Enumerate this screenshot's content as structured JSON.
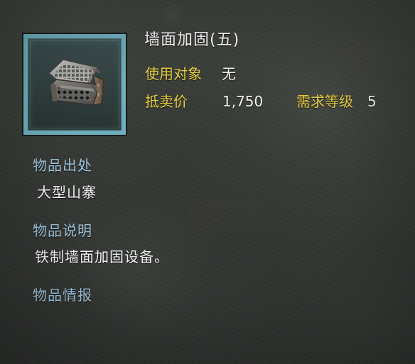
{
  "item": {
    "title": "墙面加固(五)",
    "icon": "wall-reinforcement-equipment-icon"
  },
  "properties": {
    "use_target_label": "使用对象",
    "use_target_value": "无",
    "sell_price_label": "抵卖价",
    "sell_price_value": "1,750",
    "required_level_label": "需求等级",
    "required_level_value": "5"
  },
  "sections": {
    "source_title": "物品出处",
    "source_value": "大型山寨",
    "description_title": "物品说明",
    "description_value": "铁制墙面加固设备。",
    "intel_title": "物品情报"
  },
  "colors": {
    "title": "#f2f2f2",
    "label_gold": "#e4cc43",
    "section_blue": "#9ec2da",
    "frame_teal": "#6eaebd"
  }
}
